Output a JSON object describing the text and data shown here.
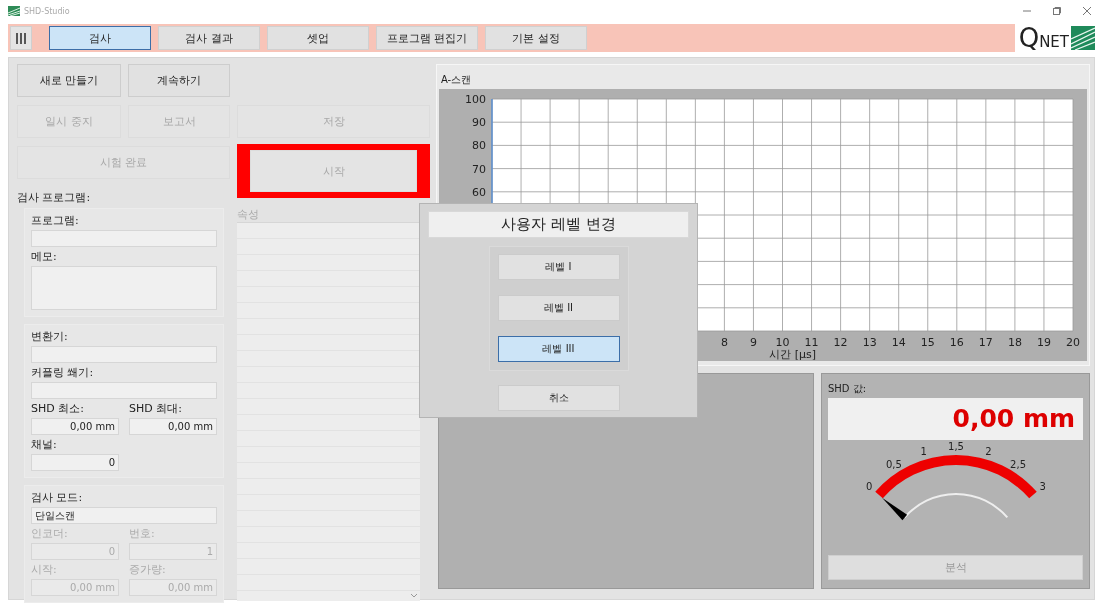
{
  "window": {
    "title": "SHD-Studio"
  },
  "tabs": [
    {
      "label": "검사",
      "selected": true
    },
    {
      "label": "검사 결과",
      "selected": false
    },
    {
      "label": "셋업",
      "selected": false
    },
    {
      "label": "프로그램 편집기",
      "selected": false
    },
    {
      "label": "기본 설정",
      "selected": false
    }
  ],
  "logo": "QNET",
  "actions": [
    {
      "label": "새로 만들기",
      "disabled": false,
      "highlighted": false
    },
    {
      "label": "계속하기",
      "disabled": false,
      "highlighted": false
    },
    {
      "label": "일시 중지",
      "disabled": true,
      "highlighted": false
    },
    {
      "label": "보고서",
      "disabled": true,
      "highlighted": false
    },
    {
      "label": "저장",
      "disabled": true,
      "highlighted": false
    },
    {
      "label": "시험 완료",
      "disabled": true,
      "highlighted": false
    },
    {
      "label": "시작",
      "disabled": true,
      "highlighted": true
    }
  ],
  "program_section": {
    "title": "검사 프로그램:",
    "groups": [
      {
        "fields": [
          {
            "label": "프로그램:",
            "kind": "text",
            "disabled": false
          },
          {
            "label": "메모:",
            "kind": "memo",
            "disabled": false
          }
        ]
      },
      {
        "fields": [
          {
            "label": "변환기:",
            "kind": "text",
            "disabled": false
          },
          {
            "label": "커플링 쐐기:",
            "kind": "text",
            "disabled": false
          },
          {
            "label": "SHD 최소:",
            "value": "0,00 mm",
            "kind": "number",
            "disabled": false
          },
          {
            "label": "SHD 최대:",
            "value": "0,00 mm",
            "kind": "number",
            "disabled": false
          },
          {
            "label": "채널:",
            "value": "0",
            "kind": "number",
            "disabled": false
          }
        ]
      },
      {
        "fields": [
          {
            "label": "검사 모드:",
            "value": "단일스캔",
            "kind": "text",
            "disabled": false
          },
          {
            "label": "인코더:",
            "value": "0",
            "kind": "number",
            "disabled": true
          },
          {
            "label": "번호:",
            "value": "1",
            "kind": "number",
            "disabled": true
          },
          {
            "label": "시작:",
            "value": "0,00 mm",
            "kind": "number",
            "disabled": true
          },
          {
            "label": "증가량:",
            "value": "0,00 mm",
            "kind": "number",
            "disabled": true
          }
        ]
      }
    ]
  },
  "properties": {
    "header": "속성",
    "disabled": true
  },
  "ascan": {
    "title": "A-스캔",
    "chart_data": {
      "type": "line",
      "grid": true,
      "xlabel": "시간 [µs]",
      "xlim": [
        0,
        20
      ],
      "ylim": [
        0,
        100
      ],
      "xticks": [
        8,
        9,
        10,
        11,
        12,
        13,
        14,
        15,
        16,
        17,
        18,
        19,
        20
      ],
      "yticks": [
        60,
        70,
        80,
        90,
        100
      ]
    }
  },
  "dialog": {
    "title": "사용자 레벨 변경",
    "levels": [
      {
        "label": "레벨 I",
        "selected": false
      },
      {
        "label": "레벨 II",
        "selected": false
      },
      {
        "label": "레벨 III",
        "selected": true
      }
    ],
    "cancel": "취소"
  },
  "shd": {
    "title": "SHD 값:",
    "value": "0,00 mm",
    "gauge": {
      "labels": [
        "0",
        "0,5",
        "1",
        "1,5",
        "2",
        "2,5",
        "3"
      ]
    },
    "analyze": {
      "label": "분석",
      "disabled": true
    }
  }
}
